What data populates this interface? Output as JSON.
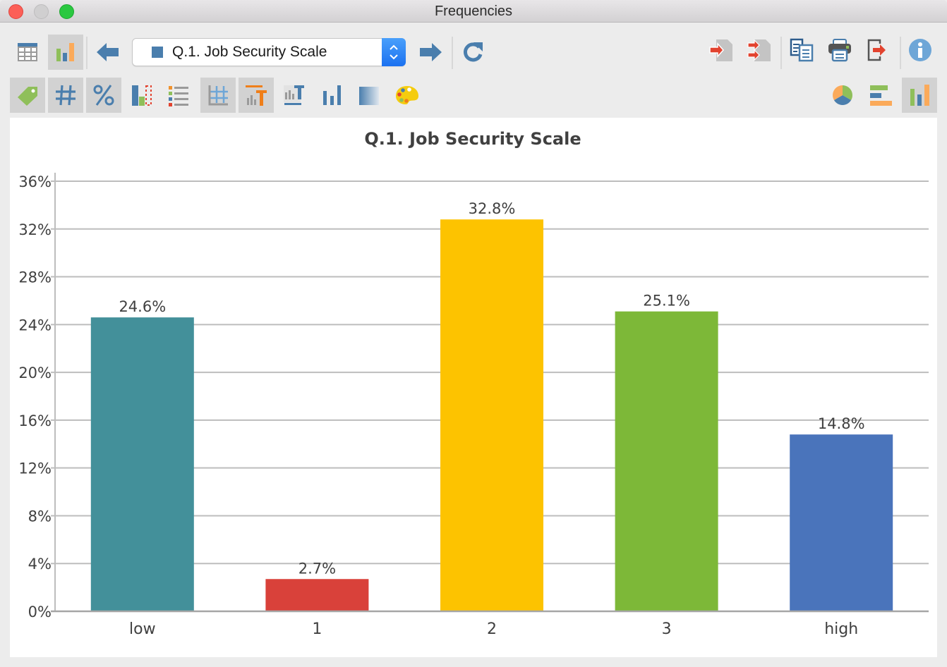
{
  "window": {
    "title": "Frequencies"
  },
  "toolbar": {
    "row1": {
      "table_view": "table-view",
      "chart_view": "chart-view",
      "prev_variable": "previous-variable",
      "variable_select": {
        "value": "Q.1. Job Security Scale",
        "marker_color": "#4a7ead"
      },
      "next_variable": "next-variable",
      "refresh": "refresh",
      "export_right": [
        "import-one",
        "import-all",
        "copy",
        "print",
        "export",
        "info"
      ]
    },
    "row2": {
      "left": [
        "value-labels",
        "absolute-frequencies",
        "percentages",
        "missing-values",
        "legend",
        "gridlines",
        "chart-title",
        "axis-title",
        "data-labels",
        "gradient",
        "color-palette"
      ],
      "active": [
        "value-labels",
        "absolute-frequencies",
        "percentages",
        "gridlines",
        "chart-title"
      ],
      "right": [
        "pie-chart",
        "horizontal-bar-chart",
        "vertical-bar-chart"
      ],
      "right_active": "vertical-bar-chart"
    }
  },
  "chart_data": {
    "type": "bar",
    "title": "Q.1. Job Security Scale",
    "xlabel": "",
    "ylabel": "",
    "categories": [
      "low",
      "1",
      "2",
      "3",
      "high"
    ],
    "values": [
      24.6,
      2.7,
      32.8,
      25.1,
      14.8
    ],
    "value_labels": [
      "24.6%",
      "2.7%",
      "32.8%",
      "25.1%",
      "14.8%"
    ],
    "colors": [
      "#43909a",
      "#d9413a",
      "#fdc300",
      "#7db838",
      "#4a74bb"
    ],
    "ylim": [
      0,
      36
    ],
    "yticks": [
      0,
      4,
      8,
      12,
      16,
      20,
      24,
      28,
      32,
      36
    ],
    "ytick_labels": [
      "0%",
      "4%",
      "8%",
      "12%",
      "16%",
      "20%",
      "24%",
      "28%",
      "32%",
      "36%"
    ],
    "grid": true,
    "legend": "none"
  }
}
